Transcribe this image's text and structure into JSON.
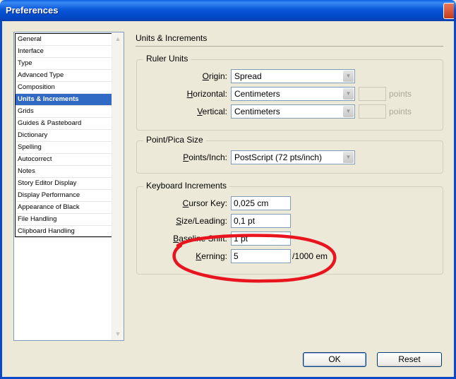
{
  "window": {
    "title": "Preferences"
  },
  "sidebar": {
    "items": [
      {
        "label": "General",
        "selected": false
      },
      {
        "label": "Interface",
        "selected": false
      },
      {
        "label": "Type",
        "selected": false
      },
      {
        "label": "Advanced Type",
        "selected": false
      },
      {
        "label": "Composition",
        "selected": false
      },
      {
        "label": "Units & Increments",
        "selected": true
      },
      {
        "label": "Grids",
        "selected": false
      },
      {
        "label": "Guides & Pasteboard",
        "selected": false
      },
      {
        "label": "Dictionary",
        "selected": false
      },
      {
        "label": "Spelling",
        "selected": false
      },
      {
        "label": "Autocorrect",
        "selected": false
      },
      {
        "label": "Notes",
        "selected": false
      },
      {
        "label": "Story Editor Display",
        "selected": false
      },
      {
        "label": "Display Performance",
        "selected": false
      },
      {
        "label": "Appearance of Black",
        "selected": false
      },
      {
        "label": "File Handling",
        "selected": false
      },
      {
        "label": "Clipboard Handling",
        "selected": false
      }
    ]
  },
  "main": {
    "title": "Units & Increments",
    "ruler_units": {
      "legend": "Ruler Units",
      "origin": {
        "label_pre": "",
        "label_key": "O",
        "label_post": "rigin:",
        "value": "Spread"
      },
      "horizontal": {
        "label_pre": "",
        "label_key": "H",
        "label_post": "orizontal:",
        "value": "Centimeters",
        "points_value": "",
        "points_label": "points"
      },
      "vertical": {
        "label_pre": "",
        "label_key": "V",
        "label_post": "ertical:",
        "value": "Centimeters",
        "points_value": "",
        "points_label": "points"
      }
    },
    "point_pica": {
      "legend": "Point/Pica Size",
      "points_inch": {
        "label_pre": "",
        "label_key": "P",
        "label_post": "oints/Inch:",
        "value": "PostScript (72 pts/inch)"
      }
    },
    "keyboard_increments": {
      "legend": "Keyboard Increments",
      "cursor_key": {
        "label_pre": "",
        "label_key": "C",
        "label_post": "ursor Key:",
        "value": "0,025 cm"
      },
      "size_leading": {
        "label_pre": "",
        "label_key": "S",
        "label_post": "ize/Leading:",
        "value": "0,1 pt"
      },
      "baseline_shift": {
        "label_pre": "",
        "label_key": "B",
        "label_post": "aseline Shift:",
        "value": "1 pt"
      },
      "kerning": {
        "label_pre": "",
        "label_key": "K",
        "label_post": "erning:",
        "value": "5",
        "unit": "/1000 em"
      }
    }
  },
  "buttons": {
    "ok": "OK",
    "reset": "Reset"
  },
  "colors": {
    "annotation": "#e8141e",
    "selection": "#316ac5",
    "titlebar": "#0a56d8"
  }
}
